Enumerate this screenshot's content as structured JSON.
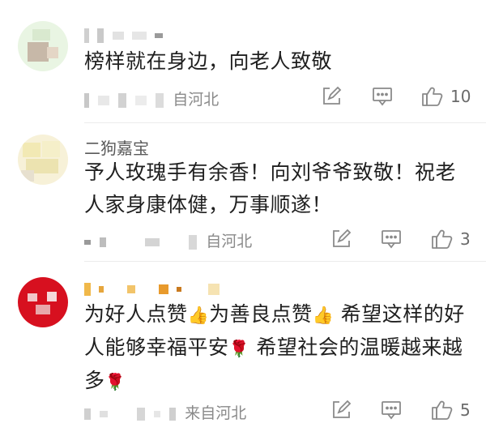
{
  "comments": [
    {
      "username": "",
      "text": "榜样就在身边，向老人致敬",
      "location": "自河北",
      "likes": "10"
    },
    {
      "username": "二狗嘉宝",
      "text": "予人玫瑰手有余香！向刘爷爷致敬！祝老人家身康体健，万事顺遂！",
      "location": "自河北",
      "likes": "3"
    },
    {
      "username": "",
      "text_part1": "为好人点赞",
      "text_part2": "为善良点赞",
      "text_part3": "希望这样的好人能够幸福平安",
      "text_part4": "希望社会的温暖越来越多",
      "location": "来自河北",
      "likes": "5"
    }
  ],
  "icons": {
    "edit": "edit-icon",
    "reply": "comment-icon",
    "like": "thumbs-up-icon",
    "thumb_emoji": "👍",
    "rose_emoji": "🌹"
  },
  "colors": {
    "text": "#1f1f1f",
    "meta": "#8a8a8a",
    "icon": "#8a8a8a",
    "avatar3": "#d7101f"
  }
}
